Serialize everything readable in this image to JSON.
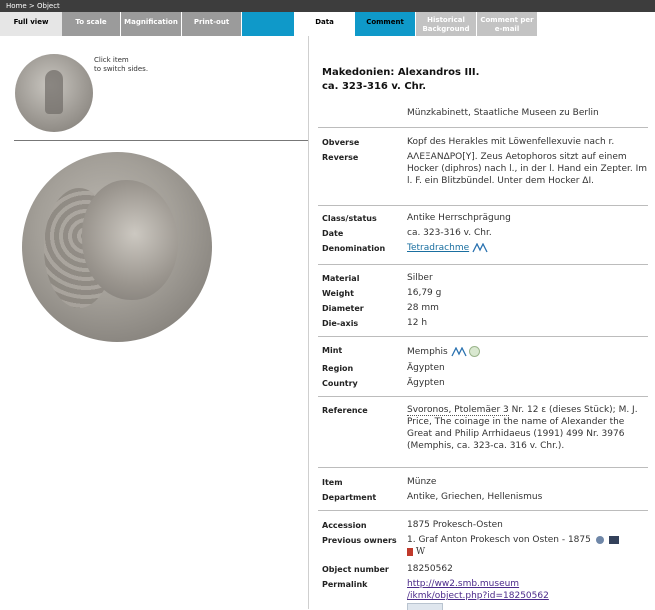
{
  "breadcrumb": "Home > Object",
  "tabs": [
    {
      "label": "Full view"
    },
    {
      "label": "To scale"
    },
    {
      "label": "Magnification"
    },
    {
      "label": "Print-out"
    },
    {
      "label": ""
    },
    {
      "label": "Data"
    },
    {
      "label": "Comment"
    },
    {
      "line1": "Historical",
      "line2": "Background"
    },
    {
      "line1": "Comment per",
      "line2": "e-mail"
    }
  ],
  "hint": {
    "line1": "Click item",
    "line2": "to switch sides."
  },
  "object": {
    "title1": "Makedonien: Alexandros III.",
    "title2": "ca. 323-316 v. Chr.",
    "museum": "Münzkabinett, Staatliche Museen zu Berlin"
  },
  "fields": {
    "obverse_label": "Obverse",
    "obverse": "Kopf des Herakles mit Löwenfellexuvie nach r.",
    "reverse_label": "Reverse",
    "reverse": "ΑΛΕΞΑΝΔΡΟ[Υ]. Zeus Aetophoros sitzt auf einem Hocker (diphros) nach l., in der l. Hand ein Zepter. Im l. F. ein Blitzbündel. Unter dem Hocker ΔΙ.",
    "class_label": "Class/status",
    "class": "Antike Herrschprägung",
    "date_label": "Date",
    "date": "ca. 323-316 v. Chr.",
    "denom_label": "Denomination",
    "denom": "Tetradrachme",
    "material_label": "Material",
    "material": "Silber",
    "weight_label": "Weight",
    "weight": "16,79 g",
    "diameter_label": "Diameter",
    "diameter": "28 mm",
    "dieaxis_label": "Die-axis",
    "dieaxis": "12 h",
    "mint_label": "Mint",
    "mint": "Memphis",
    "region_label": "Region",
    "region": "Ägypten",
    "country_label": "Country",
    "country": "Ägypten",
    "reference_label": "Reference",
    "ref_link": "Svoronos, Ptolemäer 3",
    "ref_text": " Nr. 12 ε (dieses Stück); M. J. Price, The coinage in the name of Alexander the Great and Philip Arrhidaeus (1991) 499 Nr. 3976 (Memphis, ca. 323-ca. 316 v. Chr.).",
    "item_label": "Item",
    "item": "Münze",
    "department_label": "Department",
    "department": "Antike, Griechen, Hellenismus",
    "accession_label": "Accession",
    "accession": "1875 Prokesch-Osten",
    "prev_label": "Previous owners",
    "prev": "1. Graf Anton Prokesch von Osten - 1875",
    "objnum_label": "Object number",
    "objnum": "18250562",
    "permalink_label": "Permalink",
    "permalink1": "http://ww2.smb.museum",
    "permalink2": "/ikmk/object.php?id=18250562"
  },
  "colors": {
    "accent": "#0f99c9",
    "topbar": "#3d3d3d",
    "tab_gray": "#9b9b9b"
  }
}
